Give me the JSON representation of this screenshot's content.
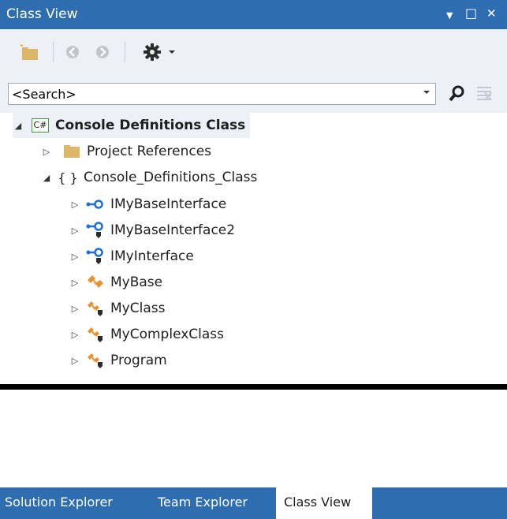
{
  "window": {
    "title": "Class View",
    "controls": {
      "dropdown": "▼",
      "maximize": "□",
      "close": "✕"
    }
  },
  "search": {
    "value": "<Search>"
  },
  "tree": {
    "project": {
      "badge": "C#",
      "label": "Console Definitions Class"
    },
    "references": {
      "label": "Project References"
    },
    "namespace": {
      "glyph": "{ }",
      "label": "Console_Definitions_Class"
    },
    "items": [
      {
        "label": "IMyBaseInterface",
        "icon": "interface-icon"
      },
      {
        "label": "IMyBaseInterface2",
        "icon": "interface-internal-icon"
      },
      {
        "label": "IMyInterface",
        "icon": "interface-internal-icon"
      },
      {
        "label": "MyBase",
        "icon": "class-icon"
      },
      {
        "label": "MyClass",
        "icon": "class-internal-icon"
      },
      {
        "label": "MyComplexClass",
        "icon": "class-internal-icon"
      },
      {
        "label": "Program",
        "icon": "class-internal-icon"
      }
    ]
  },
  "tabs": [
    {
      "label": "Solution Explorer"
    },
    {
      "label": "Team Explorer"
    },
    {
      "label": "Class View",
      "active": true
    }
  ],
  "colors": {
    "accent": "#2d6db0",
    "toolbar": "#eef0f7",
    "interface": "#1c6fd6",
    "class": "#e8912d"
  }
}
